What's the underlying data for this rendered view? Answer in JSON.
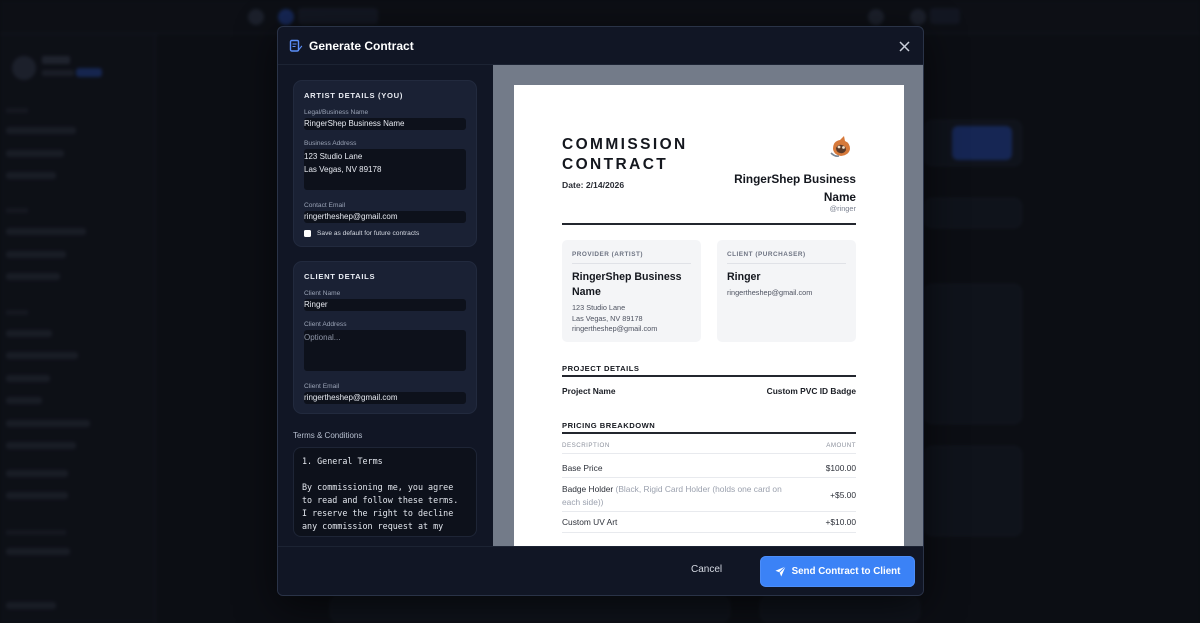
{
  "modal": {
    "title": "Generate Contract",
    "close_icon": "close-icon",
    "header_icon": "document-pen-icon"
  },
  "artist": {
    "section_title": "ARTIST DETAILS (YOU)",
    "business_name_label": "Legal/Business Name",
    "business_name": "RingerShep Business Name",
    "address_label": "Business Address",
    "address": "123 Studio Lane\nLas Vegas, NV 89178",
    "email_label": "Contact Email",
    "email": "ringertheshep@gmail.com",
    "save_default_label": "Save as default for future contracts",
    "save_default_checked": false
  },
  "client": {
    "section_title": "CLIENT DETAILS",
    "name_label": "Client Name",
    "name": "Ringer",
    "address_label": "Client Address",
    "address_placeholder": "Optional...",
    "email_label": "Client Email",
    "email": "ringertheshep@gmail.com"
  },
  "terms": {
    "label": "Terms & Conditions",
    "text": "1. General Terms\n\nBy commissioning me, you agree to read and follow these terms. I reserve the right to decline any commission request at my"
  },
  "preview": {
    "title": "COMMISSION CONTRACT",
    "date": "Date: 2/14/2026",
    "provider_name": "RingerShep Business Name",
    "provider_handle": "@ringer",
    "provider_card": {
      "head": "PROVIDER (ARTIST)",
      "name": "RingerShep Business Name",
      "address_line1": "123 Studio Lane",
      "address_line2": "Las Vegas, NV 89178",
      "email": "ringertheshep@gmail.com"
    },
    "client_card": {
      "head": "CLIENT (PURCHASER)",
      "name": "Ringer",
      "email": "ringertheshep@gmail.com"
    },
    "project_head": "PROJECT DETAILS",
    "project_name_label": "Project Name",
    "project_name": "Custom PVC ID Badge",
    "pricing_head": "PRICING BREAKDOWN",
    "col_description": "DESCRIPTION",
    "col_amount": "AMOUNT",
    "items": [
      {
        "name": "Base Price",
        "detail": "",
        "amount": "$100.00"
      },
      {
        "name": "Badge Holder",
        "detail": "(Black, Rigid Card Holder (holds one card on each side))",
        "amount": "+$5.00"
      },
      {
        "name": "Custom UV Art",
        "detail": "",
        "amount": "+$10.00"
      }
    ]
  },
  "footer": {
    "cancel_label": "Cancel",
    "send_label": "Send Contract to Client",
    "send_icon": "paper-plane-icon"
  },
  "colors": {
    "accent": "#3b82f6",
    "modal_bg": "#111625",
    "card_bg": "#1a2134",
    "preview_bg": "#737b89"
  }
}
